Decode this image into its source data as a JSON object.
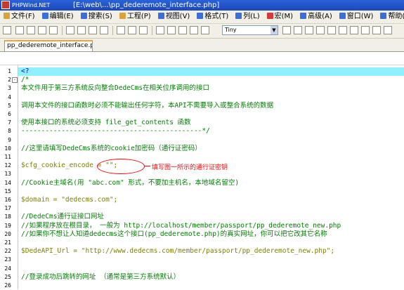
{
  "app": {
    "logo_text": "PHPWind.NET",
    "title_fragment_1": "[E:\\web\\",
    "title_fragment_2": "...\\pp_dederemote_interface.php]"
  },
  "menu": [
    {
      "label": "文件(F)",
      "icon_color": "#d8a33a"
    },
    {
      "label": "编辑(E)",
      "icon_color": "#3a6fd8"
    },
    {
      "label": "搜索(S)",
      "icon_color": "#3a6fd8"
    },
    {
      "label": "工程(P)",
      "icon_color": "#d8a33a"
    },
    {
      "label": "视图(V)",
      "icon_color": "#3a6fd8"
    },
    {
      "label": "格式(T)",
      "icon_color": "#3a6fd8"
    },
    {
      "label": "列(L)",
      "icon_color": "#3a6fd8"
    },
    {
      "label": "宏(M)",
      "icon_color": "#d83a3a"
    },
    {
      "label": "高级(A)",
      "icon_color": "#3a6fd8"
    },
    {
      "label": "窗口(W)",
      "icon_color": "#3a6fd8"
    },
    {
      "label": "帮助(H)",
      "icon_color": "#3a6fd8"
    }
  ],
  "toolbar": {
    "font_select_value": "Tiny"
  },
  "tab": {
    "label": "pp_dederemote_interface.php"
  },
  "editor": {
    "lines": [
      {
        "n": "1",
        "fold": "",
        "text": "<?",
        "kind": "php"
      },
      {
        "n": "2",
        "fold": "-",
        "text": "/*",
        "kind": "comment"
      },
      {
        "n": "3",
        "fold": "",
        "text": "本文件用于第三方系统反向整合DedeCms在相关位序调用的接口",
        "kind": "comment"
      },
      {
        "n": "4",
        "fold": "",
        "text": "",
        "kind": "comment"
      },
      {
        "n": "5",
        "fold": "",
        "text": "调用本文件的接口函数时必须不能输出任何字符，本API不需要导入或整合系统的数据",
        "kind": "comment"
      },
      {
        "n": "6",
        "fold": "",
        "text": "",
        "kind": "comment"
      },
      {
        "n": "7",
        "fold": "",
        "text": "使用本接口的系统必须支持 file_get_contents 函数",
        "kind": "comment"
      },
      {
        "n": "8",
        "fold": "",
        "text": "---------------------------------------------*/",
        "kind": "comment"
      },
      {
        "n": "9",
        "fold": "",
        "text": "",
        "kind": "default"
      },
      {
        "n": "10",
        "fold": "",
        "text": "//这里请填写DedeCms系统的cookie加密码（通行证密码）",
        "kind": "comment"
      },
      {
        "n": "11",
        "fold": "",
        "text": "",
        "kind": "default"
      },
      {
        "n": "12",
        "fold": "",
        "text": "$cfg_cookie_encode = \"\";",
        "kind": "var"
      },
      {
        "n": "13",
        "fold": "",
        "text": "",
        "kind": "default"
      },
      {
        "n": "14",
        "fold": "",
        "text": "//Cookie主域名(用 \"abc.com\" 形式，不要加主机名，本地域名留空)",
        "kind": "comment"
      },
      {
        "n": "15",
        "fold": "",
        "text": "",
        "kind": "default"
      },
      {
        "n": "16",
        "fold": "",
        "text": "$domain = \"dedecms.com\";",
        "kind": "var"
      },
      {
        "n": "17",
        "fold": "",
        "text": "",
        "kind": "default"
      },
      {
        "n": "18",
        "fold": "",
        "text": "//DedeCms通行证接口网址",
        "kind": "comment"
      },
      {
        "n": "19",
        "fold": "",
        "text": "//如果程序放在根目录， 一般为 http://localhost/member/passport/pp_dederemote_new.php",
        "kind": "comment"
      },
      {
        "n": "20",
        "fold": "",
        "text": "//如果你不想让人知道dedecms这个接口(pp_dederemote.php)的真实网址，你可以把它改其它名称",
        "kind": "comment"
      },
      {
        "n": "21",
        "fold": "",
        "text": "",
        "kind": "default"
      },
      {
        "n": "22",
        "fold": "",
        "text": "$DedeAPI_Url = \"http://www.dedecms.com/member/passport/pp_dederemote_new.php\";",
        "kind": "var"
      },
      {
        "n": "23",
        "fold": "",
        "text": "",
        "kind": "default"
      },
      {
        "n": "24",
        "fold": "",
        "text": "",
        "kind": "default"
      },
      {
        "n": "25",
        "fold": "",
        "text": "//登录成功后跳转的网址      （通常是第三方系统默认）",
        "kind": "comment"
      },
      {
        "n": "26",
        "fold": "",
        "text": "",
        "kind": "default"
      }
    ]
  },
  "annotation": {
    "text": "填写图一所示的通行证密钥",
    "color": "#ff0000"
  }
}
